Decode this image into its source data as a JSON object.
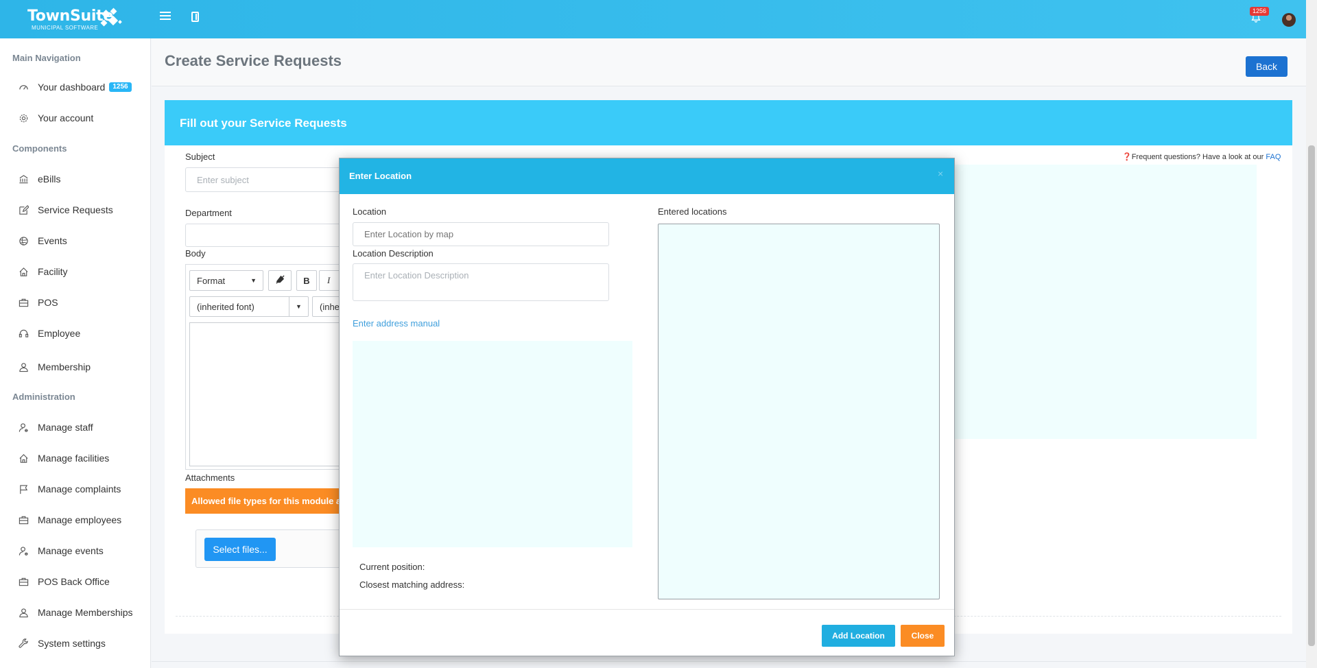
{
  "header": {
    "brand": "TownSuite",
    "brand_sub": "MUNICIPAL SOFTWARE",
    "notifications_count": "1256"
  },
  "sidebar": {
    "sections": [
      {
        "title": "Main Navigation",
        "items": [
          {
            "label": "Your dashboard",
            "icon": "dashboard-icon",
            "badge": "1256"
          },
          {
            "label": "Your account",
            "icon": "gear-icon"
          }
        ]
      },
      {
        "title": "Components",
        "items": [
          {
            "label": "eBills",
            "icon": "bank-icon"
          },
          {
            "label": "Service Requests",
            "icon": "edit-icon"
          },
          {
            "label": "Events",
            "icon": "globe-icon"
          },
          {
            "label": "Facility",
            "icon": "home-icon"
          },
          {
            "label": "POS",
            "icon": "briefcase-icon"
          },
          {
            "label": "Employee",
            "icon": "headset-icon"
          },
          {
            "label": "Membership",
            "icon": "user-icon"
          }
        ]
      },
      {
        "title": "Administration",
        "items": [
          {
            "label": "Manage staff",
            "icon": "user-gear-icon"
          },
          {
            "label": "Manage facilities",
            "icon": "home-icon"
          },
          {
            "label": "Manage complaints",
            "icon": "flag-icon"
          },
          {
            "label": "Manage employees",
            "icon": "briefcase-icon"
          },
          {
            "label": "Manage events",
            "icon": "user-gear-icon"
          },
          {
            "label": "POS Back Office",
            "icon": "briefcase-icon"
          },
          {
            "label": "Manage Memberships",
            "icon": "user-icon"
          },
          {
            "label": "System settings",
            "icon": "wrench-icon"
          }
        ]
      }
    ]
  },
  "page": {
    "title": "Create Service Requests",
    "back_label": "Back"
  },
  "form": {
    "card_title": "Fill out your Service Requests",
    "subject_label": "Subject",
    "subject_placeholder": "Enter subject",
    "department_label": "Department",
    "body_label": "Body",
    "format_label": "Format",
    "bold_label": "B",
    "italic_label": "I",
    "font_family_value": "(inherited font)",
    "font_size_value": "(inhe",
    "attachments_label": "Attachments",
    "allowed_types_text": "Allowed file types for this module ar",
    "select_files_label": "Select files...",
    "faq_text": "Frequent questions? Have a look at our ",
    "faq_link": "FAQ"
  },
  "modal": {
    "title": "Enter Location",
    "close_x": "×",
    "location_label": "Location",
    "location_placeholder": "Enter Location by map",
    "desc_label": "Location Description",
    "desc_placeholder": "Enter Location Description",
    "manual_link": "Enter address manual",
    "entered_label": "Entered locations",
    "current_position_label": "Current position:",
    "closest_address_label": "Closest matching address:",
    "add_button": "Add Location",
    "close_button": "Close"
  },
  "colors": {
    "header_bg": "#2eb5e8",
    "card_header": "#3acbf9",
    "modal_header": "#22b4e4",
    "primary_button": "#1c72d1",
    "warning": "#fb8c24",
    "map_bg": "#effefe"
  }
}
